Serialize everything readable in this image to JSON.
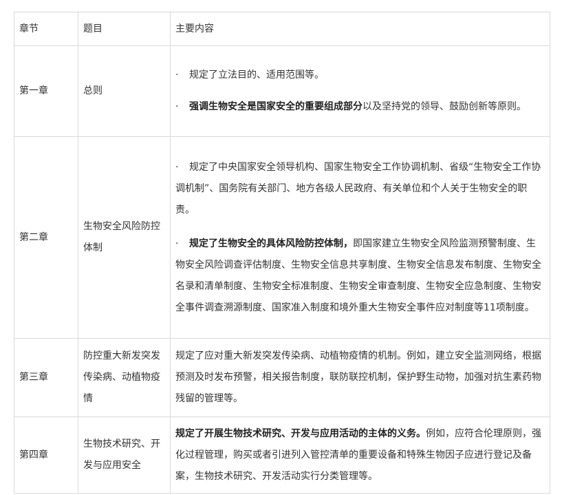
{
  "header": {
    "col1": "章节",
    "col2": "题目",
    "col3": "主要内容"
  },
  "bullet": "·",
  "rows": [
    {
      "chapter": "第一章",
      "topic": "总则",
      "items": [
        {
          "bold": "",
          "text": "规定了立法目的、适用范围等。"
        },
        {
          "bold": "强调生物安全是国家安全的重要组成部分",
          "text": "以及坚持党的领导、鼓励创新等原则。"
        }
      ]
    },
    {
      "chapter": "第二章",
      "topic": "生物安全风险防控体制",
      "items": [
        {
          "bold": "",
          "text": "规定了中央国家安全领导机构、国家生物安全工作协调机制、省级“生物安全工作协调机制”、国务院有关部门、地方各级人民政府、有关单位和个人关于生物安全的职责。"
        },
        {
          "bold": "规定了生物安全的具体风险防控体制，",
          "text": "即国家建立生物安全风险监测预警制度、生物安全风险调查评估制度、生物安全信息共享制度、生物安全信息发布制度、生物安全名录和清单制度、生物安全标准制度、生物安全审查制度、生物安全应急制度、生物安全事件调查溯源制度、国家准入制度和境外重大生物安全事件应对制度等11项制度。"
        }
      ]
    },
    {
      "chapter": "第三章",
      "topic": "防控重大新发突发传染病、动植物疫情",
      "content": "规定了应对重大新发突发传染病、动植物疫情的机制。例如，建立安全监测网络，根据预测及时发布预警，相关报告制度，联防联控机制，保护野生动物，加强对抗生素药物残留的管理等。"
    },
    {
      "chapter": "第四章",
      "topic": "生物技术研究、开发与应用安全",
      "bold": "规定了开展生物技术研究、开发与应用活动的主体的义务。",
      "content": "例如，应符合伦理原则，强化过程管理，购买或者引进列入管控清单的重要设备和特殊生物因子应进行登记及备案，生物技术研究、开发活动实行分类管理等。"
    }
  ]
}
